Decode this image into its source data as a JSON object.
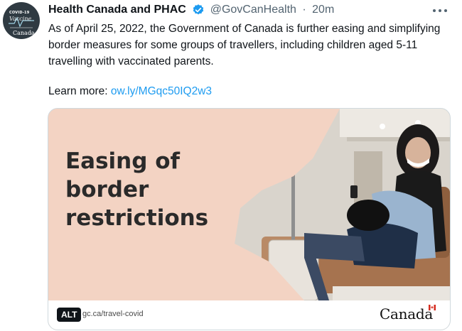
{
  "account": {
    "display_name": "Health Canada and PHAC",
    "handle": "@GovCanHealth",
    "separator": "·",
    "timestamp": "20m",
    "avatar": {
      "line1": "COVID-19",
      "line2": "Vaccine",
      "wordmark": "Canada"
    }
  },
  "tweet": {
    "text": "As of April 25, 2022, the Government of Canada is further easing and simplifying border measures for some groups of travellers, including children aged 5-11 travelling with vaccinated parents.",
    "learn_more_label": "Learn more:",
    "link_text": "ow.ly/MGqc50IQ2w3"
  },
  "media": {
    "headline": "Easing of border restrictions",
    "alt_label": "ALT",
    "url": "gc.ca/travel-covid",
    "wordmark": "Canada"
  },
  "icons": {
    "verified": "verified-badge-icon",
    "more": "more-options-icon"
  },
  "colors": {
    "link": "#1d9bf0",
    "verified": "#1d9bf0",
    "media_background": "#f3d3c3",
    "secondary_text": "#536471",
    "canada_red": "#d52b1e"
  }
}
